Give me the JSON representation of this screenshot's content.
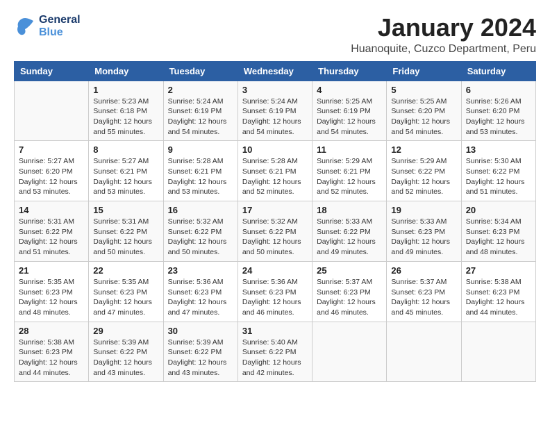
{
  "logo": {
    "line1": "General",
    "line2": "Blue"
  },
  "title": "January 2024",
  "subtitle": "Huanoquite, Cuzco Department, Peru",
  "days_of_week": [
    "Sunday",
    "Monday",
    "Tuesday",
    "Wednesday",
    "Thursday",
    "Friday",
    "Saturday"
  ],
  "weeks": [
    [
      {
        "day": "",
        "info": ""
      },
      {
        "day": "1",
        "info": "Sunrise: 5:23 AM\nSunset: 6:18 PM\nDaylight: 12 hours\nand 55 minutes."
      },
      {
        "day": "2",
        "info": "Sunrise: 5:24 AM\nSunset: 6:19 PM\nDaylight: 12 hours\nand 54 minutes."
      },
      {
        "day": "3",
        "info": "Sunrise: 5:24 AM\nSunset: 6:19 PM\nDaylight: 12 hours\nand 54 minutes."
      },
      {
        "day": "4",
        "info": "Sunrise: 5:25 AM\nSunset: 6:19 PM\nDaylight: 12 hours\nand 54 minutes."
      },
      {
        "day": "5",
        "info": "Sunrise: 5:25 AM\nSunset: 6:20 PM\nDaylight: 12 hours\nand 54 minutes."
      },
      {
        "day": "6",
        "info": "Sunrise: 5:26 AM\nSunset: 6:20 PM\nDaylight: 12 hours\nand 53 minutes."
      }
    ],
    [
      {
        "day": "7",
        "info": "Sunrise: 5:27 AM\nSunset: 6:20 PM\nDaylight: 12 hours\nand 53 minutes."
      },
      {
        "day": "8",
        "info": "Sunrise: 5:27 AM\nSunset: 6:21 PM\nDaylight: 12 hours\nand 53 minutes."
      },
      {
        "day": "9",
        "info": "Sunrise: 5:28 AM\nSunset: 6:21 PM\nDaylight: 12 hours\nand 53 minutes."
      },
      {
        "day": "10",
        "info": "Sunrise: 5:28 AM\nSunset: 6:21 PM\nDaylight: 12 hours\nand 52 minutes."
      },
      {
        "day": "11",
        "info": "Sunrise: 5:29 AM\nSunset: 6:21 PM\nDaylight: 12 hours\nand 52 minutes."
      },
      {
        "day": "12",
        "info": "Sunrise: 5:29 AM\nSunset: 6:22 PM\nDaylight: 12 hours\nand 52 minutes."
      },
      {
        "day": "13",
        "info": "Sunrise: 5:30 AM\nSunset: 6:22 PM\nDaylight: 12 hours\nand 51 minutes."
      }
    ],
    [
      {
        "day": "14",
        "info": "Sunrise: 5:31 AM\nSunset: 6:22 PM\nDaylight: 12 hours\nand 51 minutes."
      },
      {
        "day": "15",
        "info": "Sunrise: 5:31 AM\nSunset: 6:22 PM\nDaylight: 12 hours\nand 50 minutes."
      },
      {
        "day": "16",
        "info": "Sunrise: 5:32 AM\nSunset: 6:22 PM\nDaylight: 12 hours\nand 50 minutes."
      },
      {
        "day": "17",
        "info": "Sunrise: 5:32 AM\nSunset: 6:22 PM\nDaylight: 12 hours\nand 50 minutes."
      },
      {
        "day": "18",
        "info": "Sunrise: 5:33 AM\nSunset: 6:22 PM\nDaylight: 12 hours\nand 49 minutes."
      },
      {
        "day": "19",
        "info": "Sunrise: 5:33 AM\nSunset: 6:23 PM\nDaylight: 12 hours\nand 49 minutes."
      },
      {
        "day": "20",
        "info": "Sunrise: 5:34 AM\nSunset: 6:23 PM\nDaylight: 12 hours\nand 48 minutes."
      }
    ],
    [
      {
        "day": "21",
        "info": "Sunrise: 5:35 AM\nSunset: 6:23 PM\nDaylight: 12 hours\nand 48 minutes."
      },
      {
        "day": "22",
        "info": "Sunrise: 5:35 AM\nSunset: 6:23 PM\nDaylight: 12 hours\nand 47 minutes."
      },
      {
        "day": "23",
        "info": "Sunrise: 5:36 AM\nSunset: 6:23 PM\nDaylight: 12 hours\nand 47 minutes."
      },
      {
        "day": "24",
        "info": "Sunrise: 5:36 AM\nSunset: 6:23 PM\nDaylight: 12 hours\nand 46 minutes."
      },
      {
        "day": "25",
        "info": "Sunrise: 5:37 AM\nSunset: 6:23 PM\nDaylight: 12 hours\nand 46 minutes."
      },
      {
        "day": "26",
        "info": "Sunrise: 5:37 AM\nSunset: 6:23 PM\nDaylight: 12 hours\nand 45 minutes."
      },
      {
        "day": "27",
        "info": "Sunrise: 5:38 AM\nSunset: 6:23 PM\nDaylight: 12 hours\nand 44 minutes."
      }
    ],
    [
      {
        "day": "28",
        "info": "Sunrise: 5:38 AM\nSunset: 6:23 PM\nDaylight: 12 hours\nand 44 minutes."
      },
      {
        "day": "29",
        "info": "Sunrise: 5:39 AM\nSunset: 6:22 PM\nDaylight: 12 hours\nand 43 minutes."
      },
      {
        "day": "30",
        "info": "Sunrise: 5:39 AM\nSunset: 6:22 PM\nDaylight: 12 hours\nand 43 minutes."
      },
      {
        "day": "31",
        "info": "Sunrise: 5:40 AM\nSunset: 6:22 PM\nDaylight: 12 hours\nand 42 minutes."
      },
      {
        "day": "",
        "info": ""
      },
      {
        "day": "",
        "info": ""
      },
      {
        "day": "",
        "info": ""
      }
    ]
  ]
}
